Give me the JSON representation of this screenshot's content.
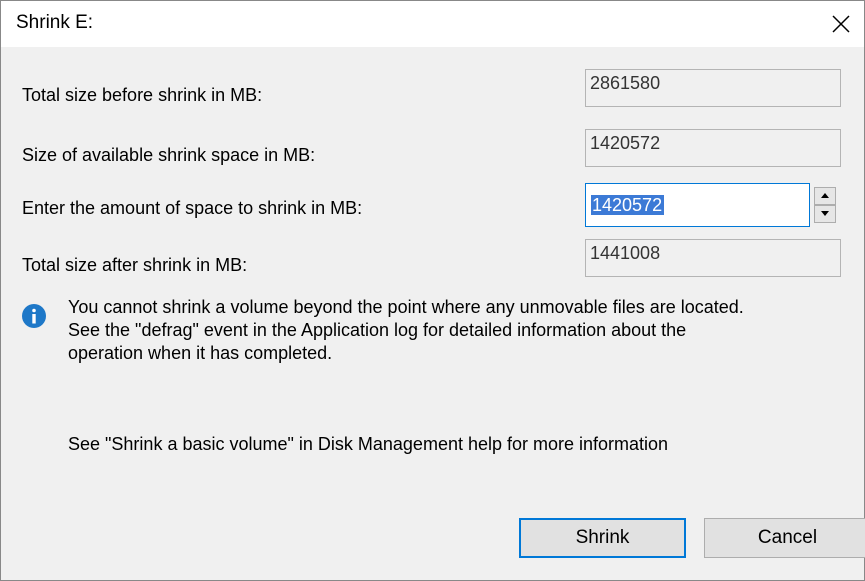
{
  "window": {
    "title": "Shrink E:",
    "close_icon": "close-icon"
  },
  "fields": [
    {
      "label": "Total size before shrink in MB:",
      "value": "2861580"
    },
    {
      "label": "Size of available shrink space in MB:",
      "value": "1420572"
    },
    {
      "label": "Enter the amount of space to shrink in MB:",
      "value": "1420572"
    },
    {
      "label": "Total size after shrink in MB:",
      "value": "1441008"
    }
  ],
  "info": {
    "icon": "info-icon",
    "lines": [
      "You cannot shrink a volume beyond the point where any unmovable files are located.",
      "See the \"defrag\" event in the Application log for detailed information about the",
      "operation when it has completed."
    ]
  },
  "help_text": "See \"Shrink a basic volume\" in Disk Management help for more information",
  "buttons": {
    "shrink": "Shrink",
    "cancel": "Cancel"
  },
  "colors": {
    "accent": "#0078d7",
    "selection": "#3c7ad6",
    "info_icon": "#1e78c8"
  }
}
